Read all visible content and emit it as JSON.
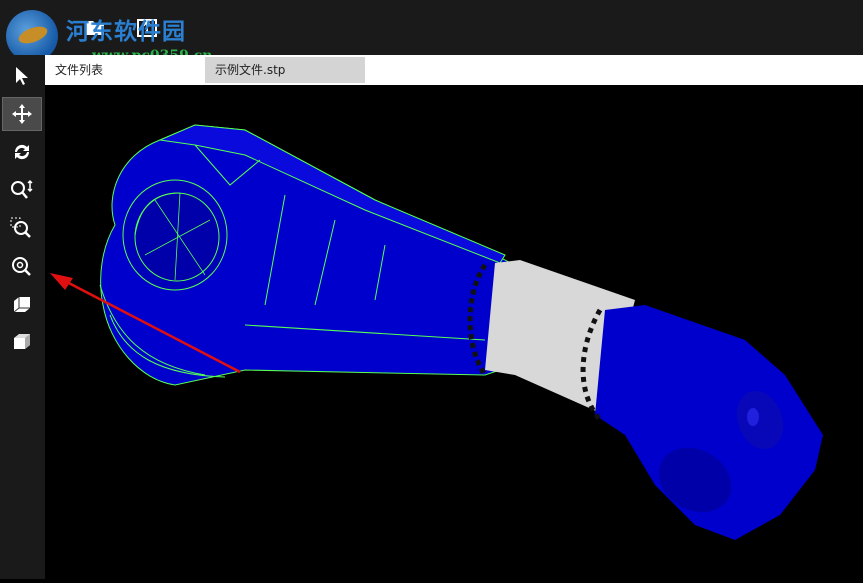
{
  "watermark": {
    "title": "河东软件园",
    "url": "www.pc0359.cn"
  },
  "topbar": {
    "icons": [
      "open-file-icon",
      "upload-icon"
    ]
  },
  "tabs": [
    {
      "label": "文件列表",
      "active": true
    },
    {
      "label": "示例文件.stp",
      "active": false
    }
  ],
  "toolbar": {
    "tools": [
      {
        "icon": "select-arrow-icon",
        "active": false
      },
      {
        "icon": "pan-move-icon",
        "active": true
      },
      {
        "icon": "rotate-icon",
        "active": false
      },
      {
        "icon": "zoom-icon",
        "active": false
      },
      {
        "icon": "zoom-window-icon",
        "active": false
      },
      {
        "icon": "zoom-fit-icon",
        "active": false
      },
      {
        "icon": "view-3d-icon",
        "active": false
      },
      {
        "icon": "solid-cube-icon",
        "active": false
      }
    ]
  },
  "colors": {
    "model_blue": "#0000cc",
    "edge_green": "#55ff55",
    "sleeve_gray": "#d8d8d8",
    "annotation_arrow": "#e01010"
  }
}
